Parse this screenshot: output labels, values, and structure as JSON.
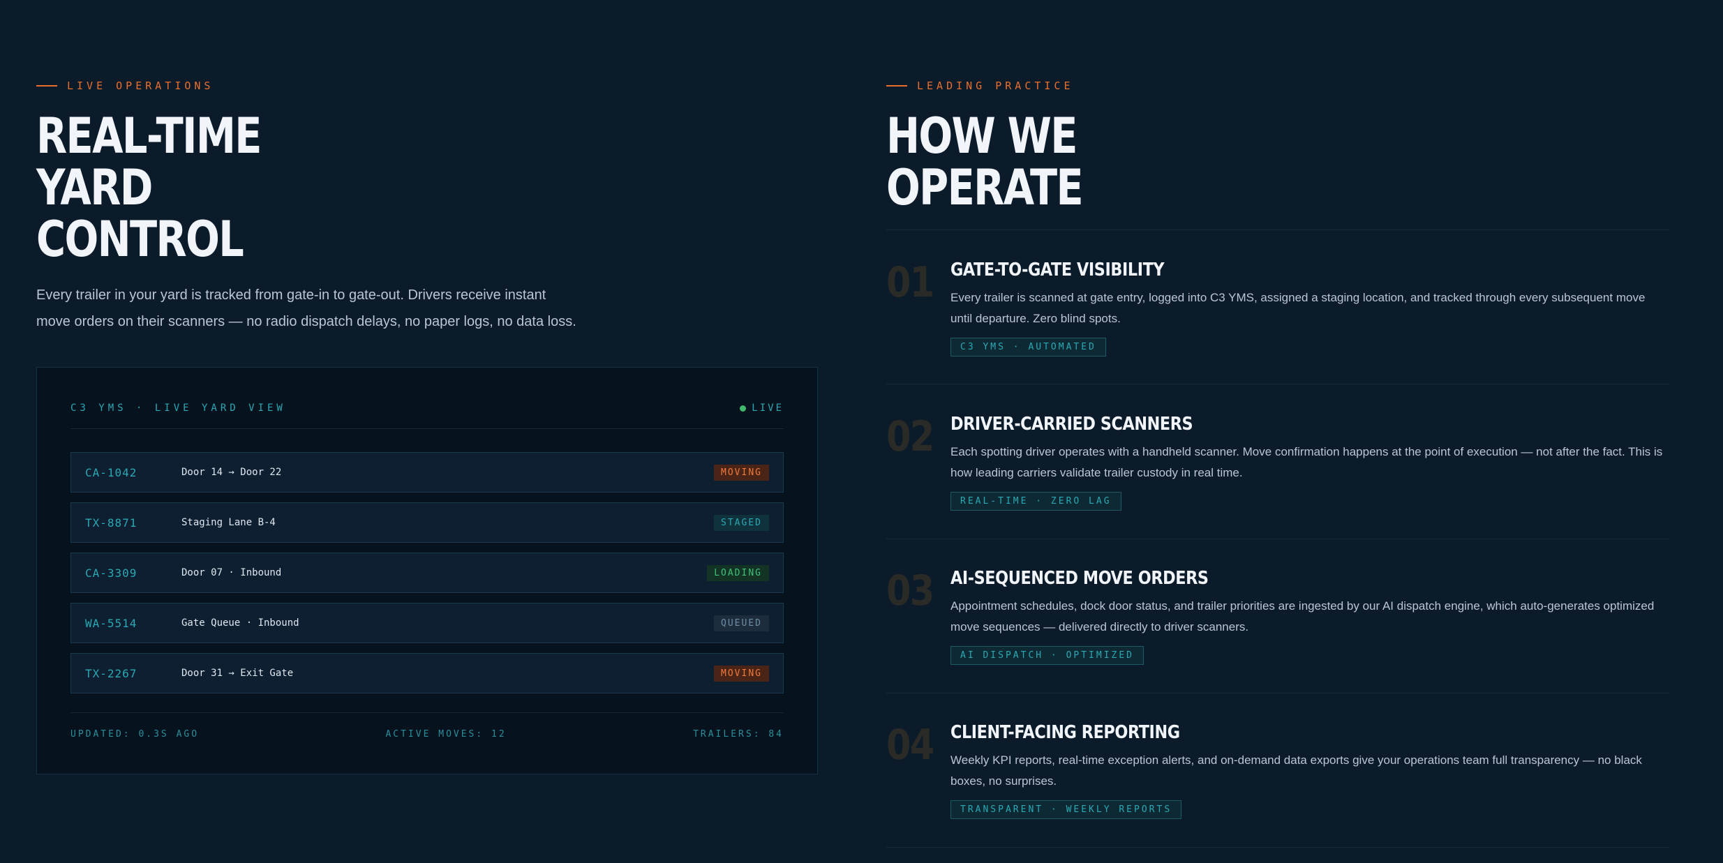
{
  "left": {
    "eyebrow": "LIVE OPERATIONS",
    "headline": [
      "REAL-TIME",
      "YARD",
      "CONTROL"
    ],
    "lead": "Every trailer in your yard is tracked from gate-in to gate-out. Drivers receive instant move orders on their scanners — no radio dispatch delays, no paper logs, no data loss.",
    "panel": {
      "title": "C3 YMS · LIVE YARD VIEW",
      "live_label": "LIVE",
      "rows": [
        {
          "id": "CA-1042",
          "location": "Door 14 → Door 22",
          "status": "MOVING",
          "kind": "moving"
        },
        {
          "id": "TX-8871",
          "location": "Staging Lane B-4",
          "status": "STAGED",
          "kind": "staged"
        },
        {
          "id": "CA-3309",
          "location": "Door 07 · Inbound",
          "status": "LOADING",
          "kind": "loading"
        },
        {
          "id": "WA-5514",
          "location": "Gate Queue · Inbound",
          "status": "QUEUED",
          "kind": "queued"
        },
        {
          "id": "TX-2267",
          "location": "Door 31 → Exit Gate",
          "status": "MOVING",
          "kind": "moving"
        }
      ],
      "footer": {
        "updated": "UPDATED: 0.3S AGO",
        "active_moves": "ACTIVE MOVES: 12",
        "trailers": "TRAILERS: 84"
      }
    }
  },
  "right": {
    "eyebrow": "LEADING PRACTICE",
    "headline": [
      "HOW WE",
      "OPERATE"
    ],
    "items": [
      {
        "num": "01",
        "title": "GATE-TO-GATE VISIBILITY",
        "desc": "Every trailer is scanned at gate entry, logged into C3 YMS, assigned a staging location, and tracked through every subsequent move until departure. Zero blind spots.",
        "tag": "C3 YMS · AUTOMATED"
      },
      {
        "num": "02",
        "title": "DRIVER-CARRIED SCANNERS",
        "desc": "Each spotting driver operates with a handheld scanner. Move confirmation happens at the point of execution — not after the fact. This is how leading carriers validate trailer custody in real time.",
        "tag": "REAL-TIME · ZERO LAG"
      },
      {
        "num": "03",
        "title": "AI-SEQUENCED MOVE ORDERS",
        "desc": "Appointment schedules, dock door status, and trailer priorities are ingested by our AI dispatch engine, which auto-generates optimized move sequences — delivered directly to driver scanners.",
        "tag": "AI DISPATCH · OPTIMIZED"
      },
      {
        "num": "04",
        "title": "CLIENT-FACING REPORTING",
        "desc": "Weekly KPI reports, real-time exception alerts, and on-demand data exports give your operations team full transparency — no black boxes, no surprises.",
        "tag": "TRANSPARENT · WEEKLY REPORTS"
      }
    ]
  }
}
